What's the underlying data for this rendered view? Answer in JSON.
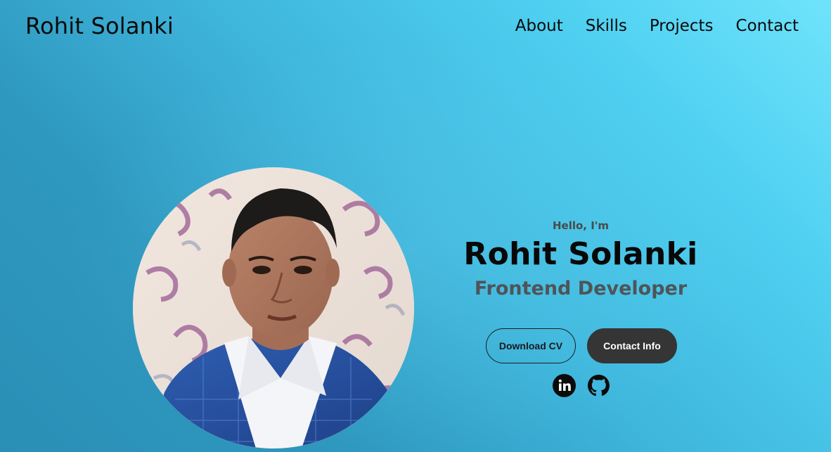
{
  "header": {
    "logo": "Rohit Solanki",
    "nav": [
      {
        "label": "About"
      },
      {
        "label": "Skills"
      },
      {
        "label": "Projects"
      },
      {
        "label": "Contact"
      }
    ]
  },
  "hero": {
    "greeting": "Hello, I'm",
    "name": "Rohit Solanki",
    "title": "Frontend Developer",
    "buttons": {
      "download_cv": "Download CV",
      "contact_info": "Contact Info"
    },
    "social_icons": [
      "linkedin-icon",
      "github-icon"
    ]
  },
  "profile_photo": {
    "alt": "Rohit Solanki profile photo"
  },
  "colors": {
    "background_light": "#6fe3fb",
    "background_dark": "#2a8fb5",
    "button_dark": "#353535",
    "text_dark": "#0a0a0a",
    "subtitle": "#4f5458"
  }
}
